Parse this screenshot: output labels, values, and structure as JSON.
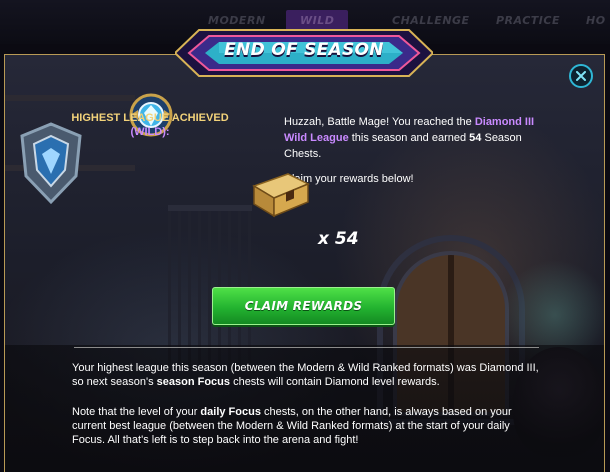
{
  "background_tabs": [
    "MODERN",
    "WILD",
    "CHALLENGE",
    "PRACTICE",
    "HO"
  ],
  "modal": {
    "title": "END OF SEASON",
    "close_icon": "close-x-icon",
    "league_label_line1": "HIGHEST LEAGUE ACHIEVED",
    "league_label_line2": "(WILD):",
    "message": {
      "greeting": "Huzzah, Battle Mage! You reached the ",
      "league_name": "Diamond III Wild League",
      "middle": " this season and earned ",
      "chest_count": "54",
      "end": " Season Chests."
    },
    "claim_prompt": "Claim your rewards below!",
    "reward_quantity": "x 54",
    "claim_button_label": "CLAIM REWARDS",
    "info1": {
      "pre": "Your highest league this season (between the Modern & Wild Ranked formats) was Diamond III, so next season's ",
      "bold": "season Focus",
      "post": " chests will contain Diamond level rewards."
    },
    "info2": {
      "pre": "Note that the level of your ",
      "bold": "daily Focus",
      "post": " chests, on the other hand, is always based on your current best league (between the Modern & Wild Ranked formats) at the start of your daily Focus. All that's left is to step back into the arena and fight!"
    }
  },
  "colors": {
    "accent_gold": "#f2d27a",
    "league_purple": "#c98aff",
    "claim_green": "#23b330",
    "close_cyan": "#2fb7d6"
  }
}
